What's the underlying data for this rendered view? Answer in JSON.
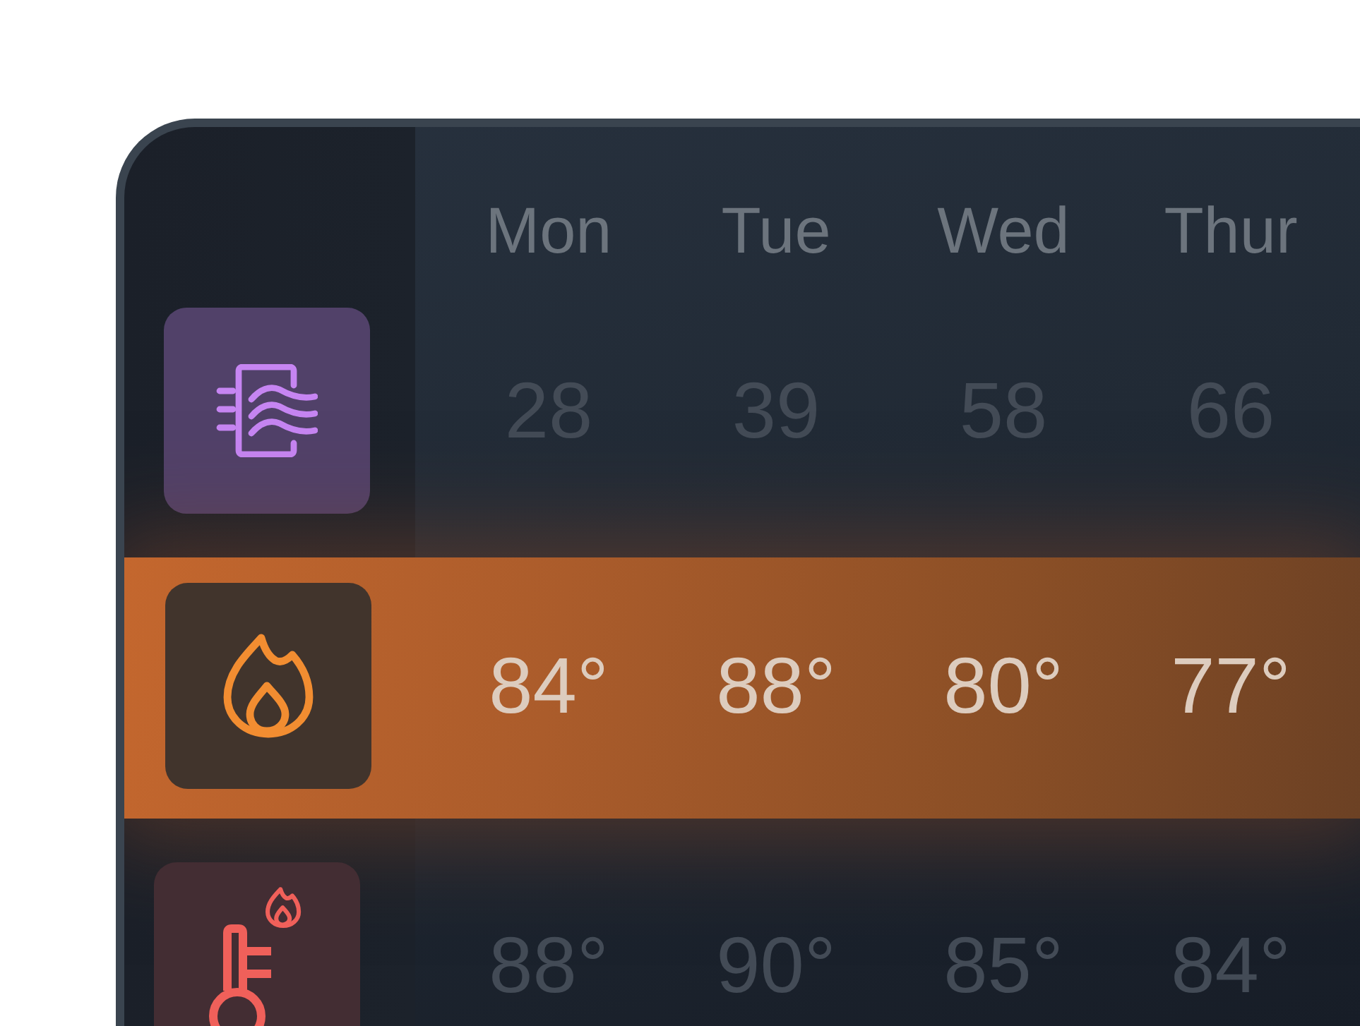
{
  "columns": [
    "Mon",
    "Tue",
    "Wed",
    "Thur"
  ],
  "rows": [
    {
      "kind": "air",
      "selected": false,
      "values": [
        "28",
        "39",
        "58",
        "66"
      ]
    },
    {
      "kind": "flame",
      "selected": true,
      "values": [
        "84°",
        "88°",
        "80°",
        "77°"
      ]
    },
    {
      "kind": "heat",
      "selected": false,
      "values": [
        "88°",
        "90°",
        "85°",
        "84°"
      ]
    }
  ]
}
